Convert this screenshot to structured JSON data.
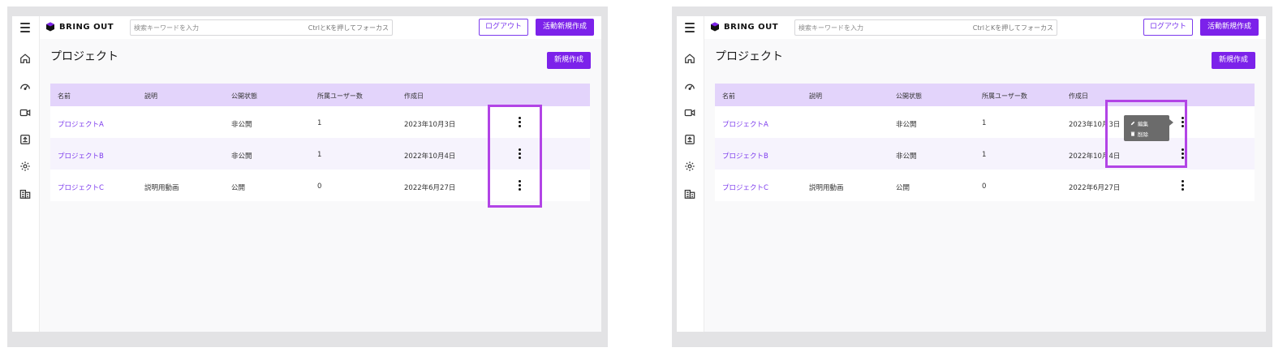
{
  "app": {
    "logo_text": "BRING OUT",
    "search_placeholder": "検索キーワードを入力",
    "search_hint": "CtrlとKを押してフォーカス",
    "logout_label": "ログアウト",
    "create_activity_label": "活動新規作成"
  },
  "page": {
    "title": "プロジェクト",
    "new_button_label": "新規作成"
  },
  "table": {
    "columns": [
      "名前",
      "説明",
      "公開状態",
      "所属ユーザー数",
      "作成日"
    ],
    "rows": [
      {
        "name": "プロジェクトA",
        "description": "",
        "visibility": "非公開",
        "users": "1",
        "created": "2023年10月3日"
      },
      {
        "name": "プロジェクトB",
        "description": "",
        "visibility": "非公開",
        "users": "1",
        "created": "2022年10月4日"
      },
      {
        "name": "プロジェクトC",
        "description": "説明用動画",
        "visibility": "公開",
        "users": "0",
        "created": "2022年6月27日"
      }
    ]
  },
  "row_menu": {
    "edit_label": "編集",
    "delete_label": "削除"
  },
  "icons": {
    "sidebar": [
      "home-icon",
      "dashboard-icon",
      "video-icon",
      "upload-icon",
      "settings-icon",
      "organization-icon"
    ]
  },
  "colors": {
    "accent": "#7c22ea",
    "header_row": "#e3d4fb",
    "highlight_border": "#b244e6"
  }
}
